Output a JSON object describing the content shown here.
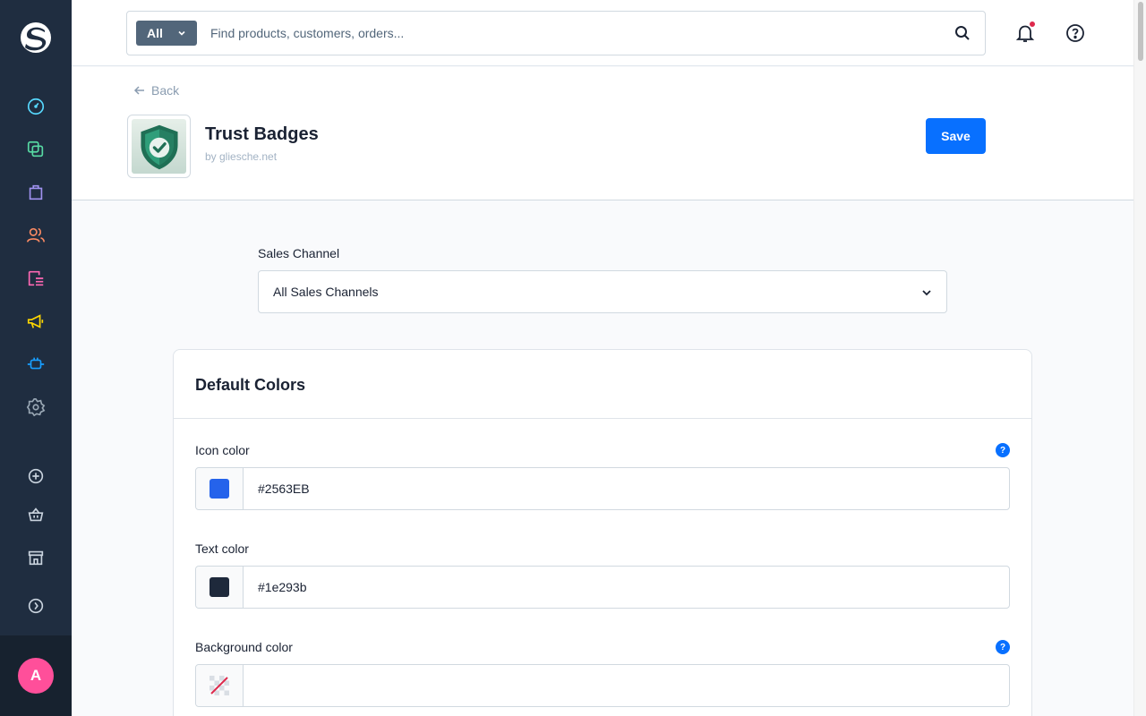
{
  "sidebar": {
    "logo": "shopware-logo",
    "items": [
      {
        "name": "dashboard-icon",
        "color": "#57d9ff"
      },
      {
        "name": "catalogues-icon",
        "color": "#57d9a3"
      },
      {
        "name": "orders-icon",
        "color": "#a092f0"
      },
      {
        "name": "customers-icon",
        "color": "#f88962"
      },
      {
        "name": "content-icon",
        "color": "#ff68b4"
      },
      {
        "name": "marketing-icon",
        "color": "#ffd700"
      },
      {
        "name": "extensions-icon",
        "color": "#189eff"
      },
      {
        "name": "settings-icon",
        "color": "#9aa8b5"
      }
    ],
    "secondary": [
      {
        "name": "add-icon"
      },
      {
        "name": "basket-icon"
      },
      {
        "name": "storefront-icon"
      },
      {
        "name": "expand-icon"
      }
    ],
    "avatar": "A"
  },
  "topbar": {
    "search_type": "All",
    "search_placeholder": "Find products, customers, orders..."
  },
  "header": {
    "back_label": "Back",
    "app_title": "Trust Badges",
    "app_by": "by gliesche.net",
    "save_label": "Save"
  },
  "content": {
    "channel_label": "Sales Channel",
    "channel_value": "All Sales Channels",
    "card_title": "Default Colors",
    "fields": [
      {
        "label": "Icon color",
        "value": "#2563EB",
        "swatch": "#2563eb",
        "help": true
      },
      {
        "label": "Text color",
        "value": "#1e293b",
        "swatch": "#1e293b",
        "help": false
      },
      {
        "label": "Background color",
        "value": "",
        "swatch": "none",
        "help": true
      }
    ],
    "help_glyph": "?"
  }
}
